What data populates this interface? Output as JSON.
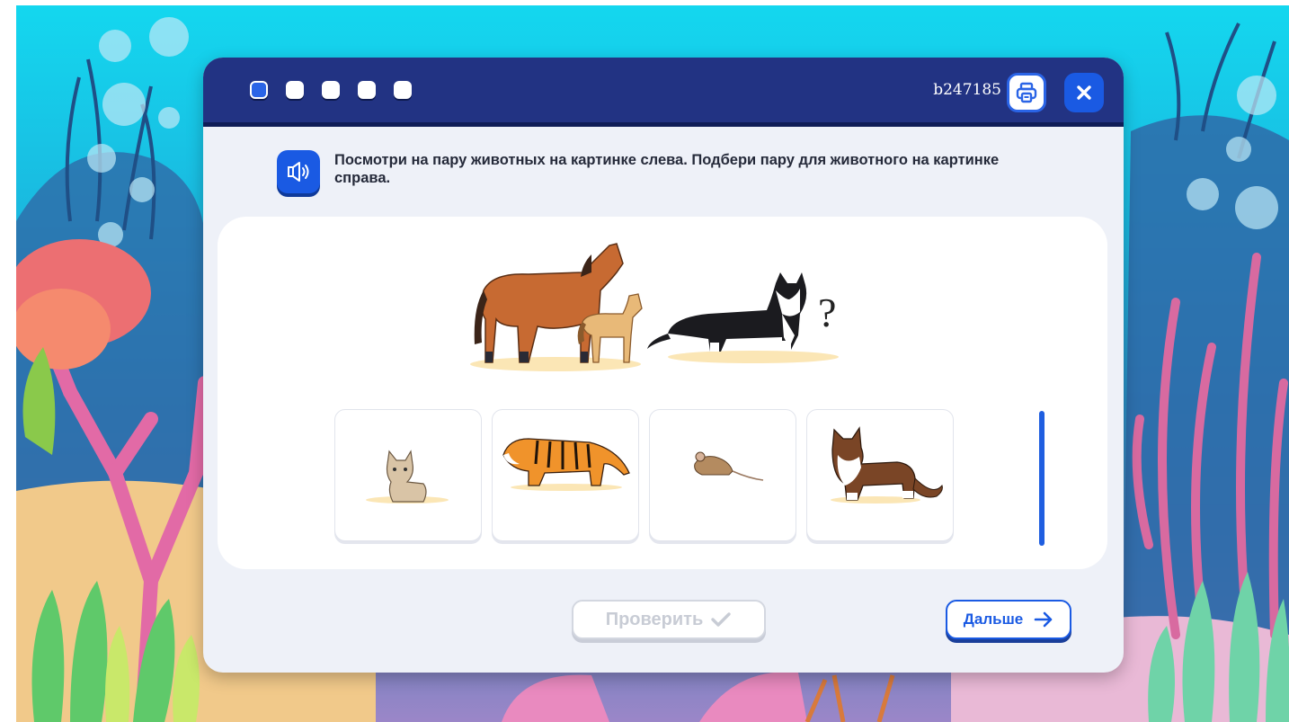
{
  "header": {
    "task_id": "b247185",
    "progress_dots": 5,
    "active_dot": 1
  },
  "instruction": {
    "text": "Посмотри на пару животных на картинке слева. Подбери пару для животного на картинке справа."
  },
  "scene": {
    "question_mark": "?"
  },
  "answers": [
    {
      "name": "kitten"
    },
    {
      "name": "tiger"
    },
    {
      "name": "mouse"
    },
    {
      "name": "cat"
    }
  ],
  "buttons": {
    "check_label": "Проверить",
    "next_label": "Дальше"
  },
  "colors": {
    "header_bg": "#223383",
    "accent": "#1a5ae3",
    "disabled_text": "#c8ccd5"
  }
}
